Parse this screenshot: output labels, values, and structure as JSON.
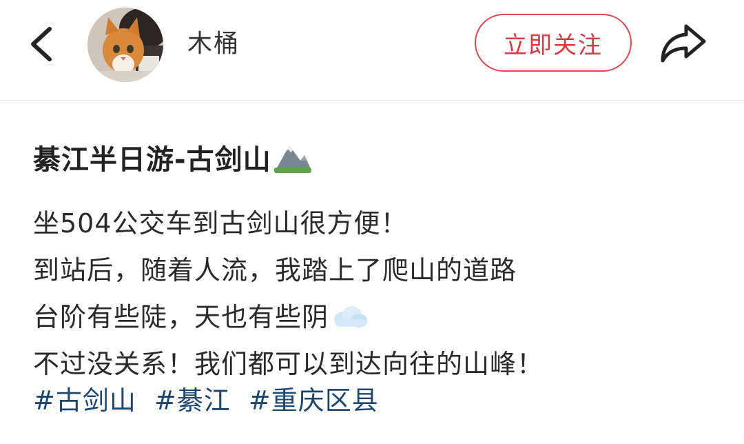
{
  "header": {
    "back_icon": "chevron-left-icon",
    "avatar_alt": "avatar",
    "username": "木桶",
    "follow_label": "立即关注",
    "share_icon": "share-arrow-icon",
    "accent_color": "#d63a43"
  },
  "note": {
    "title": "綦江半日游-古剑山",
    "title_emoji": "mountain-emoji",
    "lines": [
      "坐504公交车到古剑山很方便！",
      "到站后，随着人流，我踏上了爬山的道路",
      "台阶有些陡，天也有些阴",
      "不过没关系！我们都可以到达向往的山峰！"
    ],
    "line_emoji": "cloud-emoji",
    "tags": [
      "#古剑山",
      "#綦江",
      "#重庆区县"
    ],
    "tag_color": "#1c4670"
  }
}
